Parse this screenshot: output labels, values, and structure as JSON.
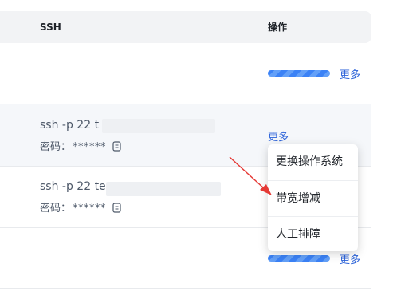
{
  "table": {
    "columns": [
      "SSH",
      "操作"
    ]
  },
  "rows": [
    {
      "more_label": "更多"
    },
    {
      "ssh_cmd": "ssh -p 22 t",
      "pwd_label": "密码：",
      "pwd_mask": "******",
      "more_label": "更多"
    },
    {
      "ssh_cmd": "ssh -p 22 tes",
      "pwd_label": "密码：",
      "pwd_mask": "******"
    },
    {
      "more_label": "更多"
    }
  ],
  "menu": {
    "items": [
      "更换操作系统",
      "带宽增减",
      "人工排障"
    ]
  },
  "colors": {
    "accent": "#2b62d9",
    "progress": "#3b82f6",
    "arrow": "#e53935"
  },
  "icons": [
    "copy-icon",
    "red-arrow-annotation"
  ]
}
